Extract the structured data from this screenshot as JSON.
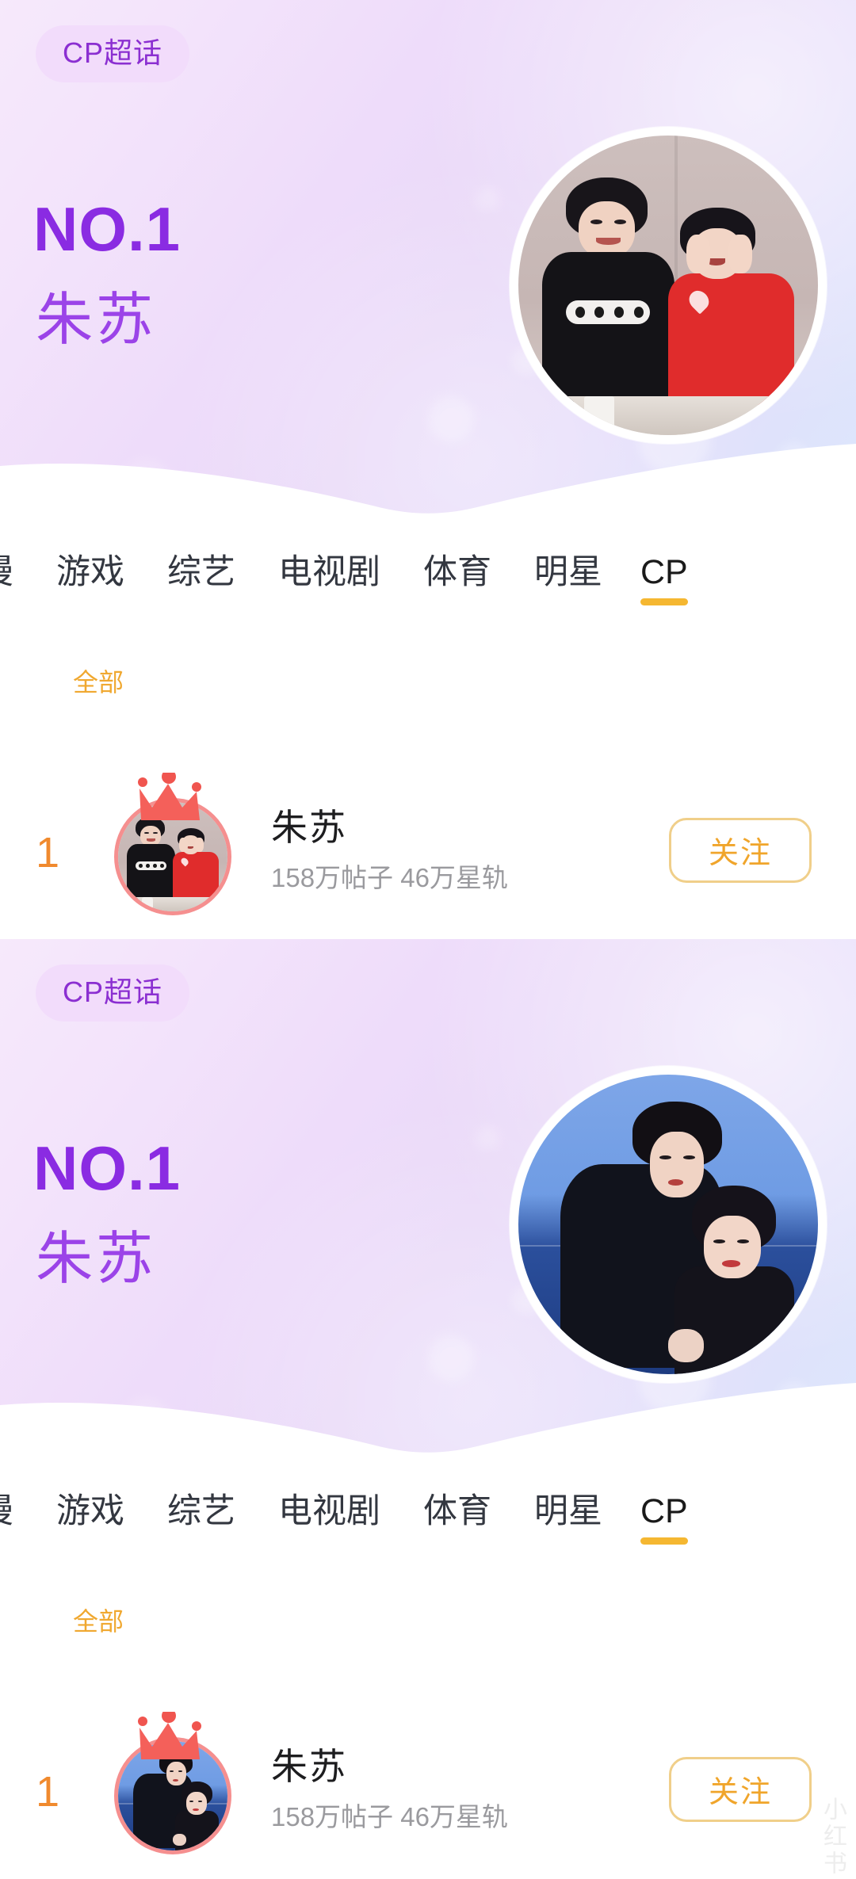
{
  "accent": {
    "purple_dark": "#8a2be2",
    "purple_light": "#9b43e8",
    "badge_bg": "#f2dcfb",
    "orange": "#f0a52b",
    "rank_orange": "#f08a2e",
    "tab_underline": "#f5b731",
    "crown_pink": "#f0554f",
    "avatar_ring": "#f58f8f"
  },
  "panels": [
    {
      "hero": {
        "badge_label": "CP超话",
        "rank_label": "NO.1",
        "name": "朱苏",
        "avatar_name": "hero-avatar-photo-indoor"
      },
      "tabs": {
        "items": [
          {
            "label": "漫",
            "active": false,
            "clipped": true
          },
          {
            "label": "游戏",
            "active": false,
            "clipped": false
          },
          {
            "label": "综艺",
            "active": false,
            "clipped": false
          },
          {
            "label": "电视剧",
            "active": false,
            "clipped": false
          },
          {
            "label": "体育",
            "active": false,
            "clipped": false
          },
          {
            "label": "明星",
            "active": false,
            "clipped": false
          },
          {
            "label": "CP",
            "active": true,
            "clipped": false
          }
        ],
        "subtab": "全部"
      },
      "list": [
        {
          "rank": "1",
          "name": "朱苏",
          "stats": "158万帖子 46万星轨",
          "follow_label": "关注",
          "avatar_name": "list-avatar-photo-indoor"
        }
      ]
    },
    {
      "hero": {
        "badge_label": "CP超话",
        "rank_label": "NO.1",
        "name": "朱苏",
        "avatar_name": "hero-avatar-photo-seaside"
      },
      "tabs": {
        "items": [
          {
            "label": "漫",
            "active": false,
            "clipped": true
          },
          {
            "label": "游戏",
            "active": false,
            "clipped": false
          },
          {
            "label": "综艺",
            "active": false,
            "clipped": false
          },
          {
            "label": "电视剧",
            "active": false,
            "clipped": false
          },
          {
            "label": "体育",
            "active": false,
            "clipped": false
          },
          {
            "label": "明星",
            "active": false,
            "clipped": false
          },
          {
            "label": "CP",
            "active": true,
            "clipped": false
          }
        ],
        "subtab": "全部"
      },
      "list": [
        {
          "rank": "1",
          "name": "朱苏",
          "stats": "158万帖子 46万星轨",
          "follow_label": "关注",
          "avatar_name": "list-avatar-photo-seaside"
        }
      ]
    }
  ],
  "watermark": "小红书"
}
